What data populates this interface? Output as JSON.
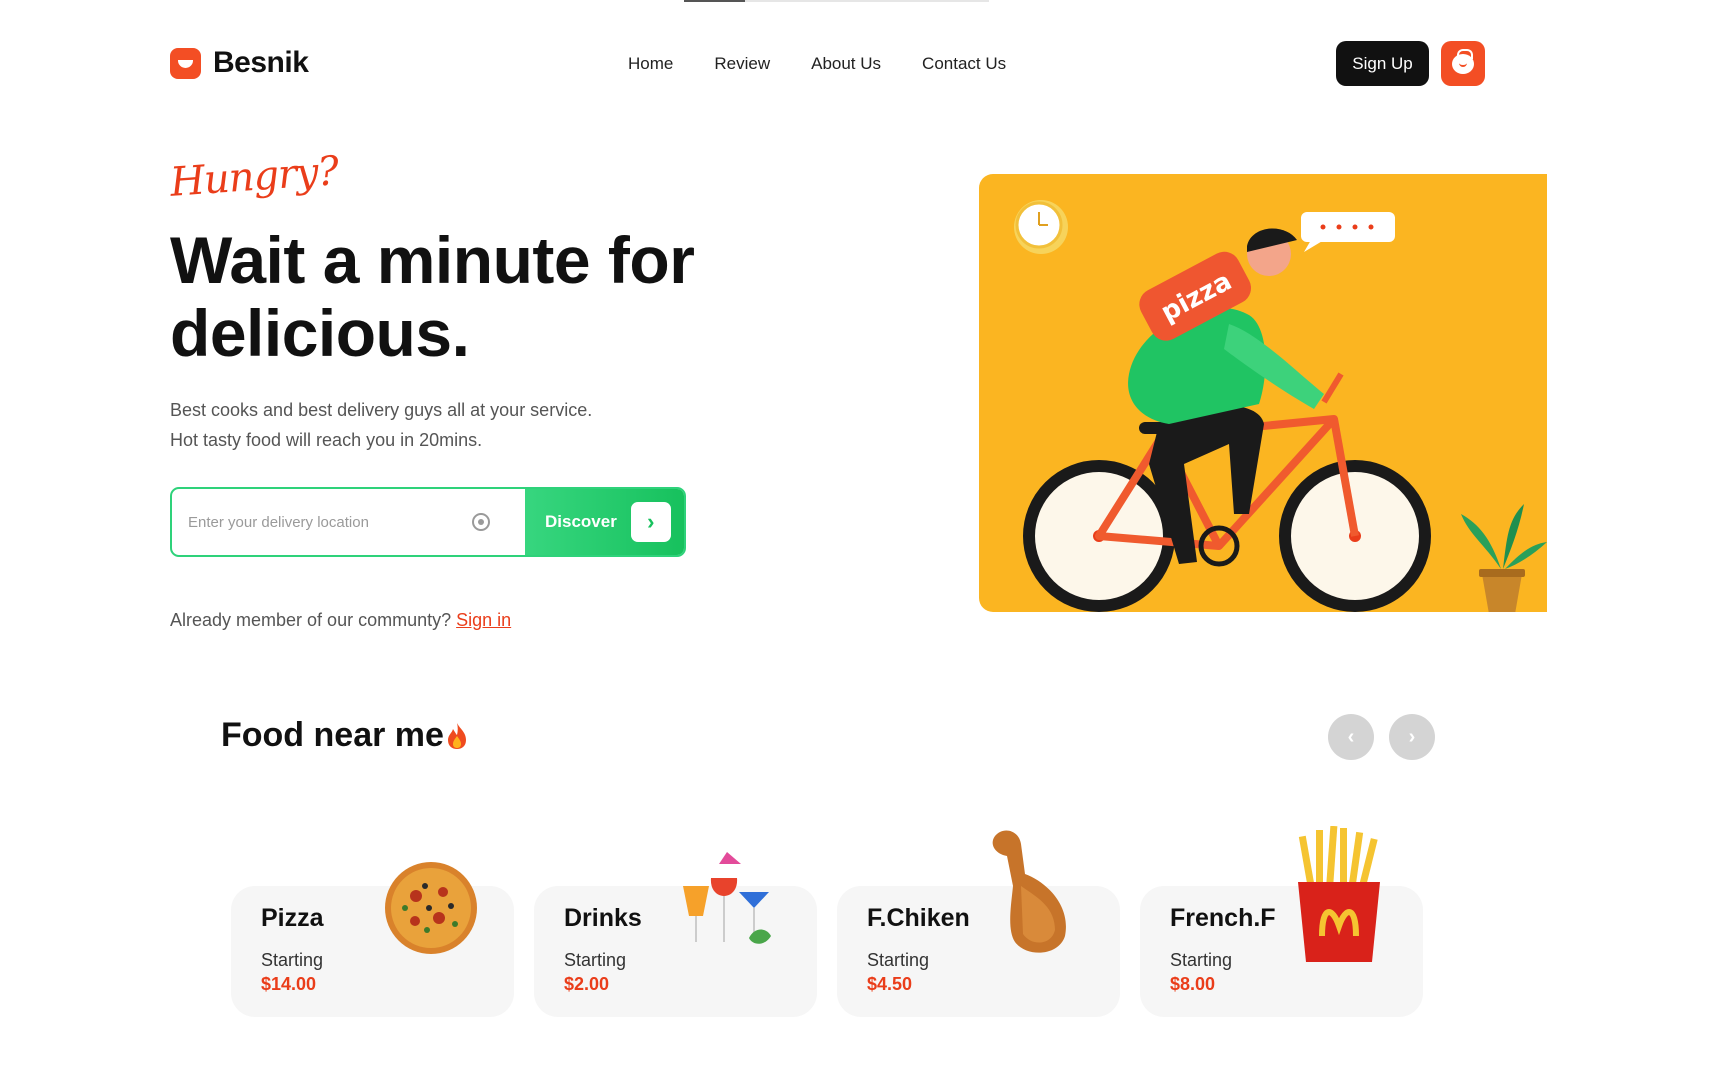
{
  "brand": {
    "name": "Besnik"
  },
  "top_progress": {
    "fraction": 0.2
  },
  "nav": {
    "items": [
      "Home",
      "Review",
      "About Us",
      "Contact Us"
    ]
  },
  "header": {
    "signup_label": "Sign Up",
    "cart_icon": "shopping-bag-icon"
  },
  "hero": {
    "eyebrow": "Hungry?",
    "title": "Wait a minute for delicious.",
    "subtitle_line1": "Best cooks and best delivery guys all at your service.",
    "subtitle_line2": "Hot tasty food will reach you in 20mins.",
    "search_placeholder": "Enter your delivery location",
    "search_value": "",
    "discover_label": "Discover",
    "member_text": "Already member of our communty?",
    "signin_label": "Sign in",
    "art": {
      "bag_text": "pizza"
    }
  },
  "colors": {
    "accent": "#f34e24",
    "green": "#1ec766",
    "yellow": "#fbb521",
    "dark": "#111111"
  },
  "foods": {
    "title": "Food near me",
    "items": [
      {
        "name": "Pizza",
        "starting_label": "Starting",
        "price": "$14.00"
      },
      {
        "name": "Drinks",
        "starting_label": "Starting",
        "price": "$2.00"
      },
      {
        "name": "F.Chiken",
        "starting_label": "Starting",
        "price": "$4.50"
      },
      {
        "name": "French.F",
        "starting_label": "Starting",
        "price": "$8.00"
      }
    ]
  }
}
